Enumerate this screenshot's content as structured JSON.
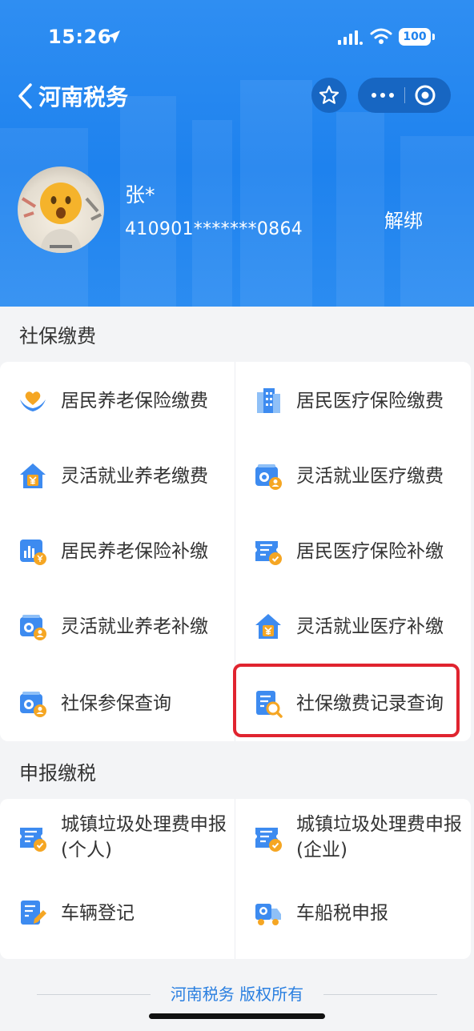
{
  "status_bar": {
    "time": "15:26",
    "battery": "100"
  },
  "nav": {
    "title": "河南税务"
  },
  "user": {
    "name": "张*",
    "id": "410901*******0864",
    "unbind_label": "解绑"
  },
  "sections": [
    {
      "title": "社保缴费",
      "items": [
        {
          "label": "居民养老保险缴费",
          "icon": "heart-hands-icon"
        },
        {
          "label": "居民医疗保险缴费",
          "icon": "building-icon"
        },
        {
          "label": "灵活就业养老缴费",
          "icon": "house-yuan-icon"
        },
        {
          "label": "灵活就业医疗缴费",
          "icon": "id-card-user-icon"
        },
        {
          "label": "居民养老保险补缴",
          "icon": "chart-yuan-icon"
        },
        {
          "label": "居民医疗保险补缴",
          "icon": "ticket-check-icon"
        },
        {
          "label": "灵活就业养老补缴",
          "icon": "id-card-user-icon"
        },
        {
          "label": "灵活就业医疗补缴",
          "icon": "house-yuan-icon"
        },
        {
          "label": "社保参保查询",
          "icon": "id-card-user-icon"
        },
        {
          "label": "社保缴费记录查询",
          "icon": "document-search-icon"
        }
      ]
    },
    {
      "title": "申报缴税",
      "items": [
        {
          "label_line1": "城镇垃圾处理费申报",
          "label_line2": "(个人)",
          "icon": "ticket-check-icon"
        },
        {
          "label_line1": "城镇垃圾处理费申报",
          "label_line2": "(企业)",
          "icon": "ticket-check-icon"
        },
        {
          "label": "车辆登记",
          "icon": "document-edit-icon"
        },
        {
          "label": "车船税申报",
          "icon": "truck-icon"
        }
      ]
    }
  ],
  "footer": {
    "text": "河南税务 版权所有"
  },
  "colors": {
    "primary": "#1e82ee",
    "highlight": "#e0242f",
    "icon_blue": "#3d8bf0",
    "icon_orange": "#f5a623"
  }
}
